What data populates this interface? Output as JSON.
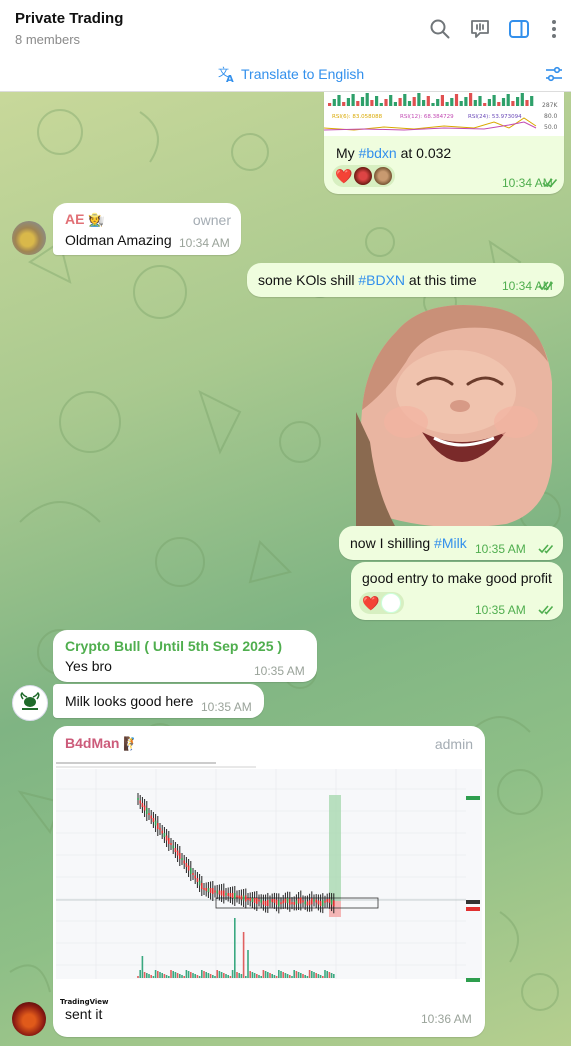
{
  "header": {
    "title": "Private Trading",
    "subtitle": "8 members"
  },
  "translate": {
    "label": "Translate to English"
  },
  "chart_top": {
    "labels": [
      "RSI(6): 83.058088",
      "RSI(12): 68.384729",
      "RSI(24): 53.973094",
      "287K",
      "80.0",
      "50.0"
    ]
  },
  "messages": {
    "m1": {
      "prefix": "My ",
      "tag": "#bdxn",
      "suffix": " at 0.032",
      "time": "10:34 AM",
      "reactions": [
        "❤️"
      ]
    },
    "m2": {
      "author": "AE",
      "author_emoji": "🧑‍🌾",
      "role": "owner",
      "text": "Oldman Amazing",
      "time": "10:34 AM"
    },
    "m3": {
      "prefix": "some KOls shill ",
      "tag": "#BDXN",
      "suffix": " at this time",
      "time": "10:34 AM"
    },
    "m4": {
      "prefix": "now I shilling ",
      "tag": "#Milk",
      "time": "10:35 AM"
    },
    "m5": {
      "text": "good entry to make good profit",
      "time": "10:35 AM",
      "reactions": [
        "❤️"
      ]
    },
    "m6": {
      "author": "Crypto Bull ( Until 5th Sep 2025 )",
      "text": "Yes bro",
      "time": "10:35 AM"
    },
    "m7": {
      "text": "Milk looks good here",
      "time": "10:35 AM"
    },
    "m8": {
      "author": "B4dMan",
      "author_emoji": "🧗",
      "role": "admin",
      "text": "sent it",
      "time": "10:36 AM",
      "tv_logo": "TradingView"
    }
  },
  "colors": {
    "accent": "#3390ec",
    "out_bubble": "#effdde",
    "in_bubble": "#ffffff",
    "check": "#4fae4e",
    "ae_name": "#e17076",
    "bull_name": "#4fae4e",
    "badman_name": "#cc5b7a"
  },
  "icons": [
    "search-icon",
    "voice-chat-icon",
    "sidebar-icon",
    "more-icon",
    "translate-icon",
    "settings-sliders-icon"
  ]
}
